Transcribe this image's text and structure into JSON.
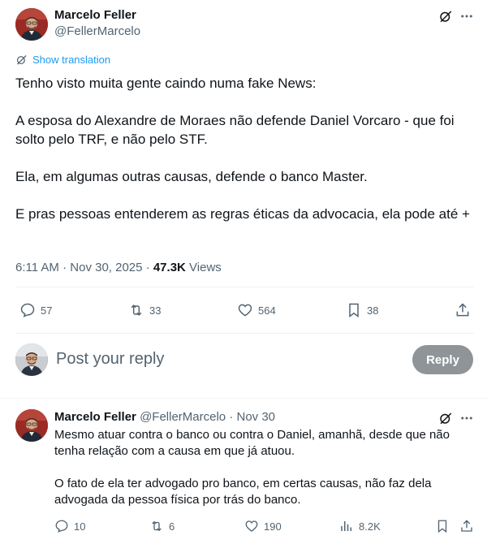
{
  "tweet": {
    "author_name": "Marcelo Feller",
    "author_handle": "@FellerMarcelo",
    "show_translation": "Show translation",
    "paragraphs": [
      "Tenho visto muita gente caindo numa fake News:",
      "A esposa do Alexandre de Moraes não defende Daniel Vorcaro - que foi solto pelo TRF, e não pelo STF.",
      "Ela, em algumas outras causas, defende o banco Master.",
      "E pras pessoas entenderem as regras éticas da advocacia, ela pode até +"
    ],
    "time": "6:11 AM",
    "date": "Nov 30, 2025",
    "views_count": "47.3K",
    "views_label": "Views",
    "stats": {
      "replies": "57",
      "reposts": "33",
      "likes": "564",
      "bookmarks": "38"
    }
  },
  "composer": {
    "placeholder": "Post your reply",
    "button_label": "Reply"
  },
  "reply": {
    "author_name": "Marcelo Feller",
    "author_handle": "@FellerMarcelo",
    "date": "Nov 30",
    "separator": "·",
    "paragraphs": [
      "Mesmo atuar contra o banco ou contra o Daniel, amanhã, desde que não tenha relação com a causa em que já atuou.",
      "O fato de ela ter advogado pro banco, em certas causas, não faz dela advogada da pessoa física por trás do banco."
    ],
    "stats": {
      "replies": "10",
      "reposts": "6",
      "likes": "190",
      "views": "8.2K"
    }
  },
  "colors": {
    "text_primary": "#0f1419",
    "text_secondary": "#536471",
    "link_blue": "#1d9bf0",
    "reply_button_bg": "#8e9497",
    "divider": "#eff3f4"
  },
  "icons": [
    "grok-icon",
    "more-icon",
    "translate-icon",
    "reply-icon",
    "repost-icon",
    "like-icon",
    "bookmark-icon",
    "share-icon",
    "views-icon"
  ]
}
